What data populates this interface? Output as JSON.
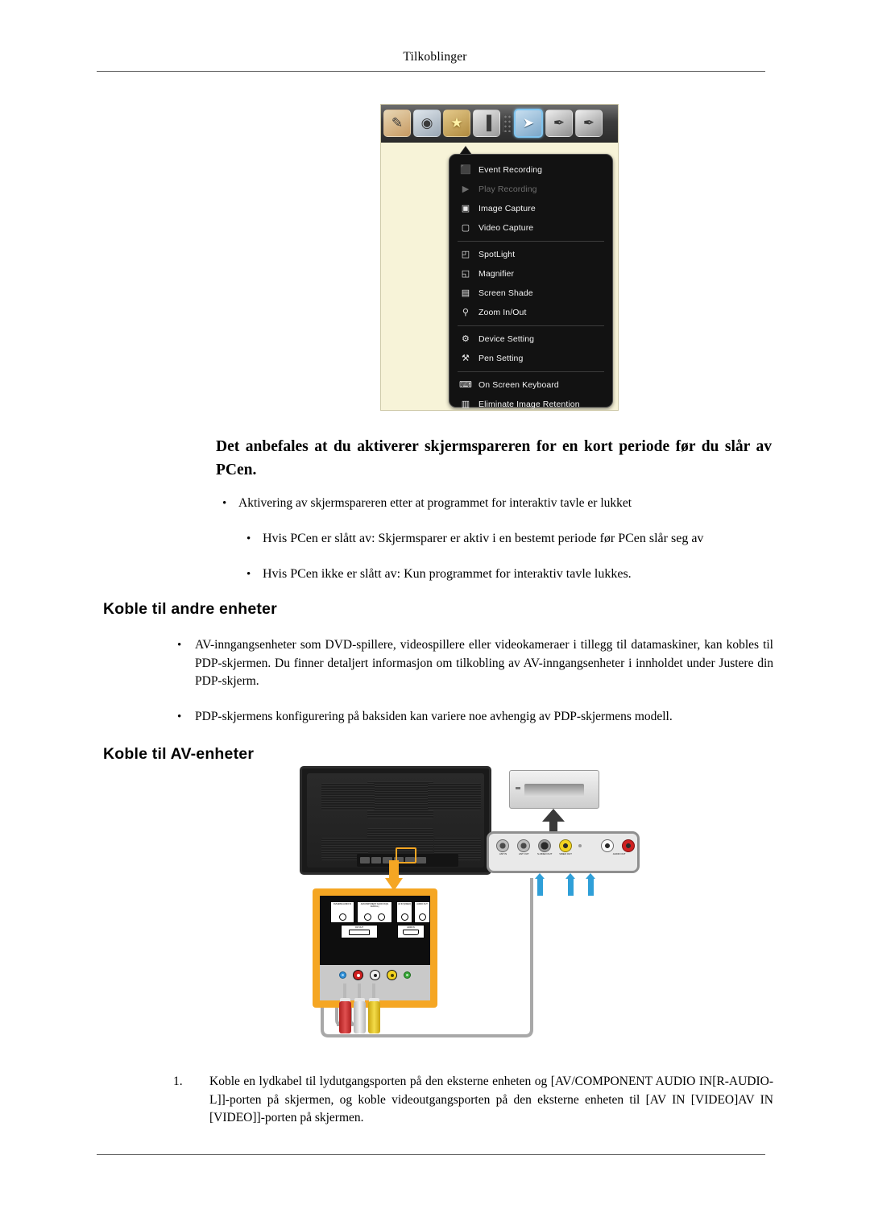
{
  "page": {
    "running_head": "Tilkoblinger"
  },
  "screenshot": {
    "toolbar": {
      "icons": [
        {
          "name": "pen-tools-icon",
          "glyph": "✎"
        },
        {
          "name": "media-clip-icon",
          "glyph": "◉"
        },
        {
          "name": "magic-star-icon",
          "glyph": "★"
        },
        {
          "name": "marker-pens-icon",
          "glyph": "▐"
        },
        {
          "name": "cursor-arrow-icon",
          "glyph": "➤"
        },
        {
          "name": "highlighter-icon",
          "glyph": "✒"
        },
        {
          "name": "red-pen-icon",
          "glyph": "✒"
        }
      ],
      "separator_name": "toolbar-drag-handle"
    },
    "menu": {
      "groups": [
        [
          {
            "label": "Event Recording",
            "icon": "event-recording-icon",
            "glyph": "⬛",
            "disabled": false
          },
          {
            "label": "Play Recording",
            "icon": "play-recording-icon",
            "glyph": "▶",
            "disabled": true
          },
          {
            "label": "Image Capture",
            "icon": "image-capture-icon",
            "glyph": "▣",
            "disabled": false
          },
          {
            "label": "Video Capture",
            "icon": "video-capture-icon",
            "glyph": "▢",
            "disabled": false
          }
        ],
        [
          {
            "label": "SpotLight",
            "icon": "spotlight-icon",
            "glyph": "◰",
            "disabled": false
          },
          {
            "label": "Magnifier",
            "icon": "magnifier-icon",
            "glyph": "◱",
            "disabled": false
          },
          {
            "label": "Screen Shade",
            "icon": "screen-shade-icon",
            "glyph": "▤",
            "disabled": false
          },
          {
            "label": "Zoom In/Out",
            "icon": "zoom-in-out-icon",
            "glyph": "⚲",
            "disabled": false
          }
        ],
        [
          {
            "label": "Device Setting",
            "icon": "device-setting-icon",
            "glyph": "⚙",
            "disabled": false
          },
          {
            "label": "Pen Setting",
            "icon": "pen-setting-icon",
            "glyph": "⚒",
            "disabled": false
          }
        ],
        [
          {
            "label": "On Screen Keyboard",
            "icon": "on-screen-keyboard-icon",
            "glyph": "⌨",
            "disabled": false
          },
          {
            "label": "Eliminate Image Retention",
            "icon": "eliminate-image-retention-icon",
            "glyph": "▥",
            "disabled": false
          }
        ]
      ]
    }
  },
  "note": {
    "heading": "Det anbefales at du aktiverer skjermspareren for en kort periode før du slår av PCen.",
    "bullets": [
      {
        "text": "Aktivering av skjermspareren etter at programmet for interaktiv tavle er lukket",
        "indent": 0
      },
      {
        "text": "Hvis PCen er slått av: Skjermsparer er aktiv i en bestemt periode før PCen slår seg av",
        "indent": 1
      },
      {
        "text": "Hvis PCen ikke er slått av: Kun programmet for interaktiv tavle lukkes.",
        "indent": 1
      }
    ]
  },
  "section_other_devices": {
    "heading": "Koble til andre enheter",
    "bullets": [
      "AV-inngangsenheter som DVD-spillere, videospillere eller videokameraer i tillegg til datamaskiner, kan kobles til PDP-skjermen. Du finner detaljert informasjon om tilkobling av AV-inngangsenheter i innholdet under Justere din PDP-skjerm.",
      "PDP-skjermens konfigurering på baksiden kan variere noe avhengig av PDP-skjermens modell."
    ]
  },
  "section_av_devices": {
    "heading": "Koble til AV-enheter",
    "diagram": {
      "display_panel_ports": [
        "DVI/HDMI AUDIO IN",
        "AV/COMPONENT AUDIO IN [R-AUDIO-L]",
        "AV IN [VIDEO]",
        "AUDIO OUT",
        "DVI OUT",
        "HDMI IN"
      ],
      "rca_jacks": [
        "blue",
        "red",
        "white",
        "yellow",
        "green"
      ],
      "external_device_ports": [
        "ANT IN",
        "ANT OUT",
        "S-VIDEO OUT",
        "VIDEO OUT",
        "AUDIO OUT"
      ],
      "highlight_color": "#F5A623",
      "cable_plugs": [
        "red",
        "white",
        "yellow"
      ]
    },
    "steps": [
      {
        "number": "1.",
        "text": "Koble en lydkabel til lydutgangsporten på den eksterne enheten og [AV/COMPONENT AUDIO IN[R-AUDIO-L]]-porten på skjermen, og koble videoutgangsporten på den eksterne enheten til [AV IN [VIDEO]AV IN [VIDEO]]-porten på skjermen."
      }
    ]
  }
}
